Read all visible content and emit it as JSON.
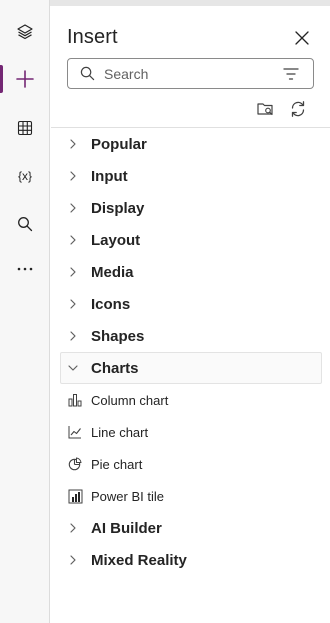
{
  "panel": {
    "title": "Insert",
    "search": {
      "placeholder": "Search",
      "value": ""
    }
  },
  "categories": [
    {
      "label": "Popular"
    },
    {
      "label": "Input"
    },
    {
      "label": "Display"
    },
    {
      "label": "Layout"
    },
    {
      "label": "Media"
    },
    {
      "label": "Icons"
    },
    {
      "label": "Shapes"
    },
    {
      "label": "Charts"
    },
    {
      "label": "AI Builder"
    },
    {
      "label": "Mixed Reality"
    }
  ],
  "charts_items": [
    {
      "label": "Column chart",
      "icon": "column-chart-icon"
    },
    {
      "label": "Line chart",
      "icon": "line-chart-icon"
    },
    {
      "label": "Pie chart",
      "icon": "pie-chart-icon"
    },
    {
      "label": "Power BI tile",
      "icon": "power-bi-icon"
    }
  ],
  "rail": {
    "items": [
      "tree-view",
      "insert",
      "data",
      "variables",
      "search",
      "more"
    ],
    "active": "insert"
  },
  "colors": {
    "accent": "#742774",
    "text": "#242424",
    "rail_bg": "#f7f7f7",
    "border": "#e0e0e0"
  }
}
